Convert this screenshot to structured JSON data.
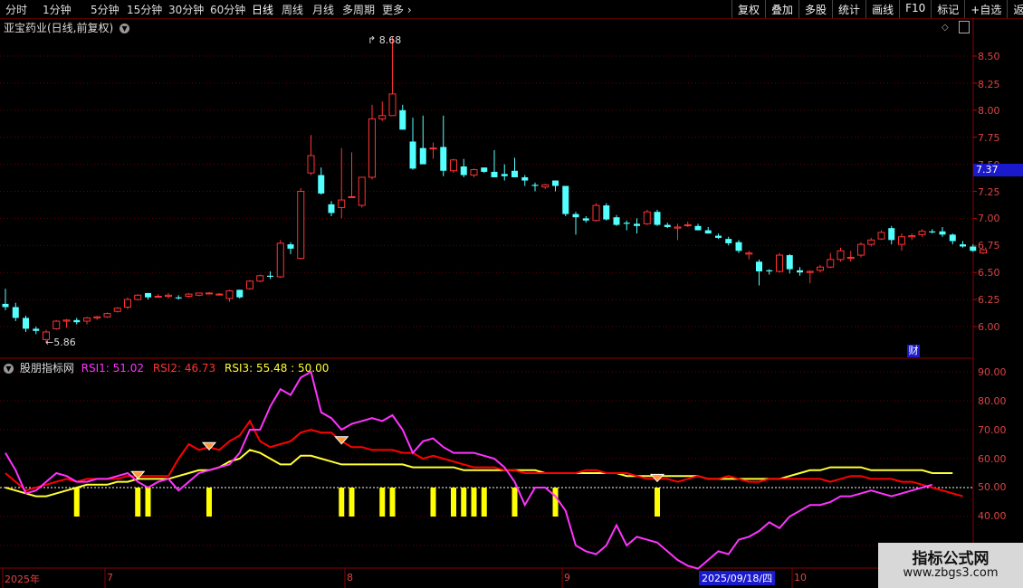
{
  "toolbar": {
    "periods": [
      "分时",
      "1分钟",
      "5分钟",
      "15分钟",
      "30分钟",
      "60分钟",
      "日线",
      "周线",
      "月线",
      "多周期",
      "更多"
    ],
    "active_period": "日线",
    "more_arrow": "›",
    "right_buttons": [
      "复权",
      "叠加",
      "多股",
      "统计",
      "画线",
      "F10",
      "标记",
      "+自选",
      "返回"
    ]
  },
  "main_chart": {
    "title": "亚宝药业(日线,前复权)",
    "dropdown_icon": "chevron-down-icon",
    "peak_label": "8.68",
    "trough_label": "5.86",
    "current_price": "7.37",
    "cai_badge": "财",
    "y_ticks": [
      "8.50",
      "8.25",
      "8.00",
      "7.75",
      "7.50",
      "7.25",
      "7.00",
      "6.75",
      "6.50",
      "6.25",
      "6.00"
    ],
    "up_color": "#ff3333",
    "down_color": "#54ffff"
  },
  "rsi_panel": {
    "name": "股朋指标网",
    "rsi1_label": "RSI1: 51.02",
    "rsi2_label": "RSI2: 46.73",
    "rsi3_label": "RSI3: 55.48 : 50.00",
    "y_ticks": [
      "90.00",
      "80.00",
      "70.00",
      "60.00",
      "50.00",
      "40.00"
    ],
    "colors": {
      "rsi1": "#ff33ff",
      "rsi2": "#ff0000",
      "rsi3": "#ffff33"
    }
  },
  "dates": {
    "labels": [
      "2025年",
      "7",
      "8",
      "9",
      "10"
    ],
    "highlight": "2025/09/18/四"
  },
  "watermark": {
    "line1": "指标公式网",
    "line2": "www.zbgs3.com"
  },
  "candles": [
    [
      6.21,
      6.35,
      6.15,
      6.18
    ],
    [
      6.18,
      6.22,
      6.05,
      6.08
    ],
    [
      6.08,
      6.1,
      5.95,
      5.98
    ],
    [
      5.98,
      6.0,
      5.93,
      5.96
    ],
    [
      5.88,
      5.97,
      5.86,
      5.95
    ],
    [
      5.98,
      6.06,
      5.97,
      6.05
    ],
    [
      6.05,
      6.07,
      5.99,
      6.06
    ],
    [
      6.06,
      6.08,
      6.02,
      6.04
    ],
    [
      6.05,
      6.09,
      6.02,
      6.08
    ],
    [
      6.08,
      6.1,
      6.06,
      6.09
    ],
    [
      6.09,
      6.13,
      6.08,
      6.12
    ],
    [
      6.14,
      6.18,
      6.13,
      6.17
    ],
    [
      6.18,
      6.27,
      6.16,
      6.25
    ],
    [
      6.25,
      6.3,
      6.24,
      6.29
    ],
    [
      6.31,
      6.31,
      6.25,
      6.27
    ],
    [
      6.28,
      6.3,
      6.27,
      6.28
    ],
    [
      6.28,
      6.31,
      6.26,
      6.29
    ],
    [
      6.27,
      6.29,
      6.25,
      6.26
    ],
    [
      6.28,
      6.31,
      6.27,
      6.3
    ],
    [
      6.29,
      6.31,
      6.28,
      6.31
    ],
    [
      6.31,
      6.32,
      6.3,
      6.31
    ],
    [
      6.3,
      6.31,
      6.29,
      6.3
    ],
    [
      6.26,
      6.34,
      6.23,
      6.33
    ],
    [
      6.34,
      6.34,
      6.26,
      6.27
    ],
    [
      6.35,
      6.43,
      6.34,
      6.42
    ],
    [
      6.42,
      6.48,
      6.41,
      6.47
    ],
    [
      6.47,
      6.51,
      6.44,
      6.46
    ],
    [
      6.46,
      6.8,
      6.45,
      6.77
    ],
    [
      6.76,
      6.78,
      6.67,
      6.72
    ],
    [
      6.63,
      7.28,
      6.62,
      7.25
    ],
    [
      7.42,
      7.77,
      7.4,
      7.58
    ],
    [
      7.4,
      7.47,
      7.22,
      7.23
    ],
    [
      7.13,
      7.16,
      7.02,
      7.05
    ],
    [
      7.1,
      7.65,
      7.0,
      7.17
    ],
    [
      7.2,
      7.61,
      7.2,
      7.2
    ],
    [
      7.12,
      7.38,
      7.1,
      7.38
    ],
    [
      7.38,
      8.05,
      7.36,
      7.92
    ],
    [
      7.92,
      8.08,
      7.9,
      7.95
    ],
    [
      7.95,
      8.68,
      7.95,
      8.15
    ],
    [
      8.0,
      8.05,
      7.82,
      7.82
    ],
    [
      7.71,
      7.93,
      7.45,
      7.46
    ],
    [
      7.65,
      7.95,
      7.64,
      7.5
    ],
    [
      7.65,
      7.7,
      7.55,
      7.65
    ],
    [
      7.66,
      7.95,
      7.39,
      7.44
    ],
    [
      7.44,
      7.55,
      7.42,
      7.54
    ],
    [
      7.48,
      7.55,
      7.38,
      7.4
    ],
    [
      7.4,
      7.46,
      7.38,
      7.45
    ],
    [
      7.47,
      7.47,
      7.42,
      7.43
    ],
    [
      7.43,
      7.63,
      7.38,
      7.38
    ],
    [
      7.41,
      7.5,
      7.35,
      7.39
    ],
    [
      7.44,
      7.56,
      7.38,
      7.38
    ],
    [
      7.38,
      7.4,
      7.3,
      7.35
    ],
    [
      7.31,
      7.33,
      7.25,
      7.3
    ],
    [
      7.29,
      7.32,
      7.27,
      7.31
    ],
    [
      7.35,
      7.35,
      7.25,
      7.3
    ],
    [
      7.3,
      7.3,
      7.02,
      7.04
    ],
    [
      7.04,
      7.06,
      6.85,
      7.01
    ],
    [
      7.0,
      7.02,
      6.96,
      6.98
    ],
    [
      6.98,
      7.14,
      6.97,
      7.12
    ],
    [
      7.12,
      7.14,
      6.98,
      6.99
    ],
    [
      7.01,
      7.03,
      6.93,
      6.94
    ],
    [
      6.96,
      6.98,
      6.89,
      6.95
    ],
    [
      6.95,
      7.0,
      6.86,
      6.93
    ],
    [
      6.95,
      7.08,
      6.94,
      7.06
    ],
    [
      7.06,
      7.08,
      6.93,
      6.94
    ],
    [
      6.94,
      6.96,
      6.91,
      6.92
    ],
    [
      6.91,
      6.95,
      6.8,
      6.92
    ],
    [
      6.94,
      6.97,
      6.92,
      6.94
    ],
    [
      6.93,
      6.95,
      6.89,
      6.89
    ],
    [
      6.89,
      6.92,
      6.86,
      6.86
    ],
    [
      6.84,
      6.86,
      6.81,
      6.82
    ],
    [
      6.81,
      6.83,
      6.75,
      6.77
    ],
    [
      6.78,
      6.8,
      6.68,
      6.7
    ],
    [
      6.67,
      6.7,
      6.62,
      6.68
    ],
    [
      6.6,
      6.62,
      6.38,
      6.51
    ],
    [
      6.52,
      6.53,
      6.48,
      6.51
    ],
    [
      6.51,
      6.68,
      6.5,
      6.66
    ],
    [
      6.66,
      6.67,
      6.49,
      6.53
    ],
    [
      6.52,
      6.55,
      6.47,
      6.5
    ],
    [
      6.5,
      6.52,
      6.4,
      6.51
    ],
    [
      6.52,
      6.57,
      6.5,
      6.55
    ],
    [
      6.55,
      6.68,
      6.54,
      6.62
    ],
    [
      6.62,
      6.73,
      6.6,
      6.7
    ],
    [
      6.64,
      6.7,
      6.6,
      6.64
    ],
    [
      6.66,
      6.78,
      6.64,
      6.76
    ],
    [
      6.76,
      6.82,
      6.74,
      6.8
    ],
    [
      6.81,
      6.89,
      6.8,
      6.87
    ],
    [
      6.91,
      6.93,
      6.76,
      6.8
    ],
    [
      6.76,
      6.86,
      6.7,
      6.83
    ],
    [
      6.83,
      6.86,
      6.8,
      6.84
    ],
    [
      6.85,
      6.9,
      6.83,
      6.88
    ],
    [
      6.88,
      6.9,
      6.86,
      6.87
    ],
    [
      6.88,
      6.92,
      6.83,
      6.85
    ],
    [
      6.85,
      6.86,
      6.76,
      6.79
    ],
    [
      6.76,
      6.79,
      6.73,
      6.74
    ],
    [
      6.74,
      6.76,
      6.69,
      6.7
    ],
    [
      6.68,
      6.72,
      6.67,
      6.71
    ]
  ],
  "rsi1_values": [
    62,
    56,
    48,
    49,
    52,
    55,
    54,
    52,
    52,
    53,
    53,
    54,
    55,
    52,
    50,
    52,
    53,
    49,
    52,
    55,
    56,
    57,
    58,
    62,
    70,
    70,
    78,
    84,
    82,
    88,
    90,
    76,
    74,
    70,
    72,
    73,
    74,
    73,
    75,
    70,
    62,
    66,
    67,
    64,
    62,
    62,
    62,
    61,
    60,
    57,
    52,
    44,
    50,
    50,
    47,
    42,
    30,
    28,
    27,
    30,
    37,
    30,
    33,
    32,
    31,
    28,
    25,
    23,
    22,
    25,
    28,
    27,
    32,
    33,
    35,
    38,
    36,
    40,
    42,
    44,
    44,
    45,
    47,
    47,
    48,
    49,
    48,
    47,
    48,
    49,
    50,
    51
  ],
  "rsi2_values": [
    55,
    52,
    49,
    50,
    51,
    52,
    53,
    52,
    53,
    53,
    53,
    53,
    54,
    54,
    54,
    54,
    54,
    60,
    65,
    63,
    64,
    63,
    66,
    68,
    73,
    66,
    64,
    65,
    66,
    69,
    70,
    69,
    69,
    66,
    64,
    64,
    63,
    63,
    63,
    62,
    62,
    60,
    61,
    60,
    59,
    58,
    57,
    57,
    57,
    56,
    56,
    55,
    55,
    55,
    55,
    55,
    55,
    56,
    56,
    55,
    55,
    55,
    54,
    53,
    53,
    53,
    52,
    53,
    54,
    53,
    53,
    54,
    53,
    52,
    52,
    53,
    53,
    53,
    53,
    53,
    53,
    52,
    53,
    54,
    54,
    53,
    53,
    53,
    52,
    52,
    51,
    50,
    49,
    48,
    47
  ],
  "rsi3_values": [
    50,
    49,
    48,
    47,
    47,
    48,
    49,
    50,
    51,
    51,
    51,
    52,
    52,
    53,
    53,
    53,
    53,
    54,
    55,
    56,
    56,
    57,
    59,
    60,
    63,
    62,
    60,
    58,
    58,
    61,
    61,
    60,
    59,
    58,
    58,
    58,
    58,
    58,
    58,
    58,
    57,
    57,
    57,
    57,
    57,
    56,
    56,
    56,
    56,
    56,
    56,
    56,
    56,
    55,
    55,
    55,
    55,
    55,
    55,
    55,
    55,
    54,
    54,
    54,
    54,
    54,
    54,
    54,
    54,
    53,
    53,
    53,
    53,
    53,
    53,
    53,
    53,
    54,
    55,
    56,
    56,
    57,
    57,
    57,
    57,
    56,
    56,
    56,
    56,
    56,
    56,
    55,
    55,
    55
  ],
  "yellow_bars": [
    7,
    13,
    14,
    20,
    33,
    34,
    37,
    38,
    42,
    44,
    45,
    46,
    47,
    50,
    54,
    64
  ],
  "markers": [
    13,
    20,
    33,
    64
  ]
}
